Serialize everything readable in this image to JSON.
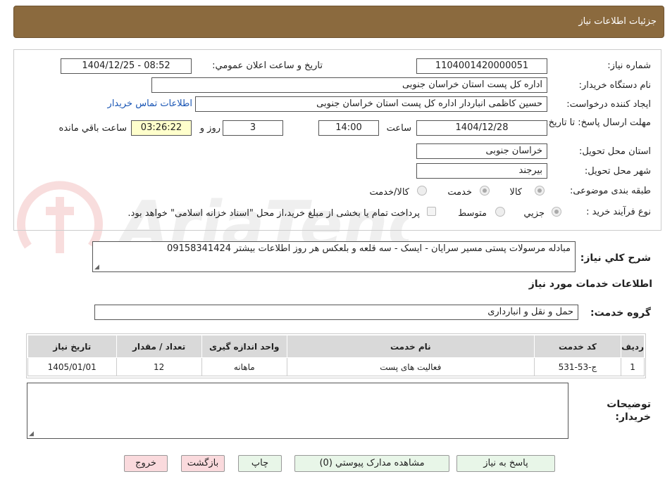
{
  "header": {
    "title": "جزئیات اطلاعات نیاز"
  },
  "form": {
    "need_number_label": "شماره نیاز:",
    "need_number": "1104001420000051",
    "announce_label": "تاریخ و ساعت اعلان عمومي:",
    "announce_value": "1404/12/25 - 08:52",
    "buyer_org_label": "نام دستگاه خریدار:",
    "buyer_org": "اداره کل پست استان خراسان جنوبی",
    "requester_label": "ایجاد کننده درخواست:",
    "requester": "حسین کاظمی انباردار اداره کل پست استان خراسان جنوبی",
    "contact_link": "اطلاعات تماس خریدار",
    "deadline_label": "مهلت ارسال پاسخ: تا تاریخ:",
    "deadline_date": "1404/12/28",
    "time_label": "ساعت",
    "deadline_time": "14:00",
    "days_value": "3",
    "days_label": "روز و",
    "remaining_time": "03:26:22",
    "remaining_label": "ساعت باقي مانده",
    "province_label": "استان محل تحویل:",
    "province": "خراسان جنوبی",
    "city_label": "شهر محل تحویل:",
    "city": "بیرجند",
    "category_label": "طبقه بندی موضوعی:",
    "category_options": [
      "کالا",
      "خدمت",
      "کالا/خدمت"
    ],
    "process_label": "نوع فرآیند خرید :",
    "process_options": [
      "جزيي",
      "متوسط"
    ],
    "payment_note": "پرداخت تمام یا بخشی از مبلغ خرید،از محل \"اسناد خزانه اسلامی\" خواهد بود."
  },
  "description": {
    "label": "شرح کلي نیاز:",
    "text": "مبادله مرسولات پستی مسیر سرایان - ایسک - سه قلعه  و بلعکس هر روز  اطلاعات بیشتر 09158341424"
  },
  "services": {
    "section_title": "اطلاعات خدمات مورد نیاز",
    "group_label": "گروه خدمت:",
    "group_value": "حمل و نقل و انبارداری",
    "columns": [
      "ردیف",
      "کد خدمت",
      "نام خدمت",
      "واحد اندازه گیری",
      "تعداد / مقدار",
      "تاریخ نیاز"
    ],
    "rows": [
      [
        "1",
        "ج-53-531",
        "فعالیت های پست",
        "ماهانه",
        "12",
        "1405/01/01"
      ]
    ]
  },
  "notes": {
    "label": "توضیحات خریدار:",
    "text": ""
  },
  "buttons": {
    "reply": "پاسخ به نیاز",
    "attachments": "مشاهده مدارک پیوستي (0)",
    "print": "چاپ",
    "back": "بازگشت",
    "exit": "خروج"
  },
  "colors": {
    "header": "#8b6a3e",
    "button_green": "#e8f6e8",
    "button_pink": "#fadadd",
    "link": "#1a56b5"
  }
}
